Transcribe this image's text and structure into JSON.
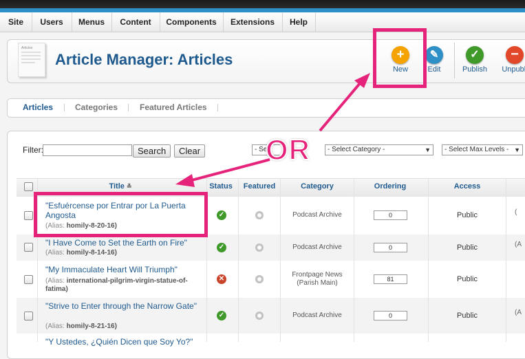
{
  "menu": {
    "items": [
      {
        "label": "Site"
      },
      {
        "label": "Users"
      },
      {
        "label": "Menus"
      },
      {
        "label": "Content"
      },
      {
        "label": "Components"
      },
      {
        "label": "Extensions"
      },
      {
        "label": "Help"
      }
    ]
  },
  "header": {
    "icon_caption": "Articles",
    "title": "Article Manager: Articles"
  },
  "toolbar": {
    "new": {
      "label": "New",
      "icon": "plus-icon",
      "color": "#f5a300"
    },
    "edit": {
      "label": "Edit",
      "icon": "pencil-icon",
      "color": "#2f8fc7"
    },
    "publish": {
      "label": "Publish",
      "icon": "check-icon",
      "color": "#3f9a2a"
    },
    "unpublish": {
      "label": "Unpubli",
      "icon": "minus-icon",
      "color": "#e2472a"
    }
  },
  "tabs": [
    {
      "label": "Articles",
      "active": true
    },
    {
      "label": "Categories",
      "active": false
    },
    {
      "label": "Featured Articles",
      "active": false
    }
  ],
  "filter": {
    "label": "Filter:",
    "value": "",
    "search_label": "Search",
    "clear_label": "Clear",
    "state_select": "- Se",
    "category_select": "- Select Category -",
    "levels_select": "- Select Max Levels -"
  },
  "table": {
    "headers": {
      "title": "Title",
      "status": "Status",
      "featured": "Featured",
      "category": "Category",
      "ordering": "Ordering",
      "access": "Access"
    },
    "rows": [
      {
        "title": "\"Esfuércense por Entrar por La Puerta Angosta",
        "alias_prefix": "(Alias:",
        "alias": "homily-8-20-16)",
        "status": "published",
        "category": "Podcast Archive",
        "ordering": "0",
        "access": "Public",
        "trunc": "("
      },
      {
        "title": "\"I Have Come to Set the Earth on Fire\"",
        "alias_prefix": "(Alias:",
        "alias": "homily-8-14-16)",
        "status": "published",
        "category": "Podcast Archive",
        "ordering": "0",
        "access": "Public",
        "trunc": "(A"
      },
      {
        "title": "\"My Immaculate Heart Will Triumph\"",
        "alias_prefix": "(Alias:",
        "alias": "international-pilgrim-virgin-statue-of-fatima)",
        "status": "unpublished",
        "category": "Frontpage News (Parish Main)",
        "ordering": "81",
        "access": "Public",
        "trunc": ""
      },
      {
        "title": "\"Strive to Enter through the Narrow Gate\"",
        "alias_prefix": "(Alias:",
        "alias": "homily-8-21-16)",
        "status": "published",
        "category": "Podcast Archive",
        "ordering": "0",
        "access": "Public",
        "trunc": "(A"
      },
      {
        "title": "\"Y Ustedes, ¿Quién Dicen que Soy Yo?\"",
        "alias_prefix": "",
        "alias": "",
        "status": "",
        "category": "",
        "ordering": "",
        "access": "",
        "trunc": ""
      }
    ]
  },
  "annotation": {
    "or_text": "OR",
    "color": "#e6237a"
  }
}
